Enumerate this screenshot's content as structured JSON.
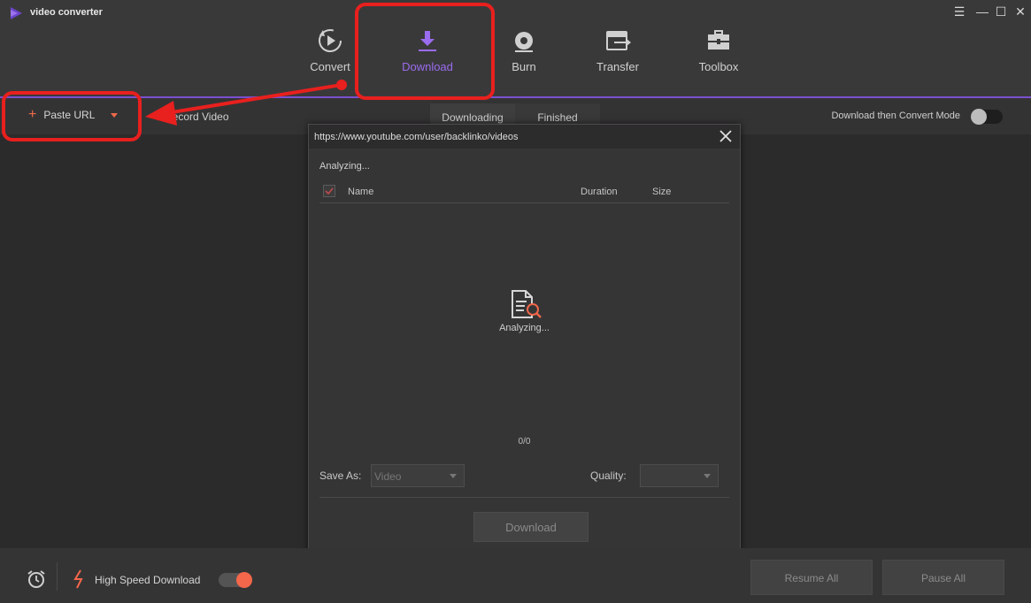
{
  "app": {
    "title": "video converter"
  },
  "window_controls": {
    "menu": "☰",
    "minimize": "—",
    "maximize": "☐",
    "close": "✕"
  },
  "nav": {
    "convert": "Convert",
    "download": "Download",
    "burn": "Burn",
    "transfer": "Transfer",
    "toolbox": "Toolbox",
    "active": "download"
  },
  "toolbar": {
    "paste_url": "Paste URL",
    "record_video": "Record Video",
    "tab_downloading": "Downloading",
    "tab_finished": "Finished",
    "mode_label": "Download then Convert Mode"
  },
  "dialog": {
    "url": "https://www.youtube.com/user/backlinko/videos",
    "status_top": "Analyzing...",
    "col_name": "Name",
    "col_duration": "Duration",
    "col_size": "Size",
    "status_center": "Analyzing...",
    "counter": "0/0",
    "save_as_label": "Save As:",
    "save_as_value": "Video",
    "quality_label": "Quality:",
    "quality_value": "",
    "download_button": "Download"
  },
  "bottom": {
    "high_speed": "High Speed Download",
    "resume_all": "Resume All",
    "pause_all": "Pause All"
  },
  "colors": {
    "accent_purple": "#9a6cf0",
    "accent_orange": "#f4674a",
    "highlight_red": "#e8201e"
  }
}
